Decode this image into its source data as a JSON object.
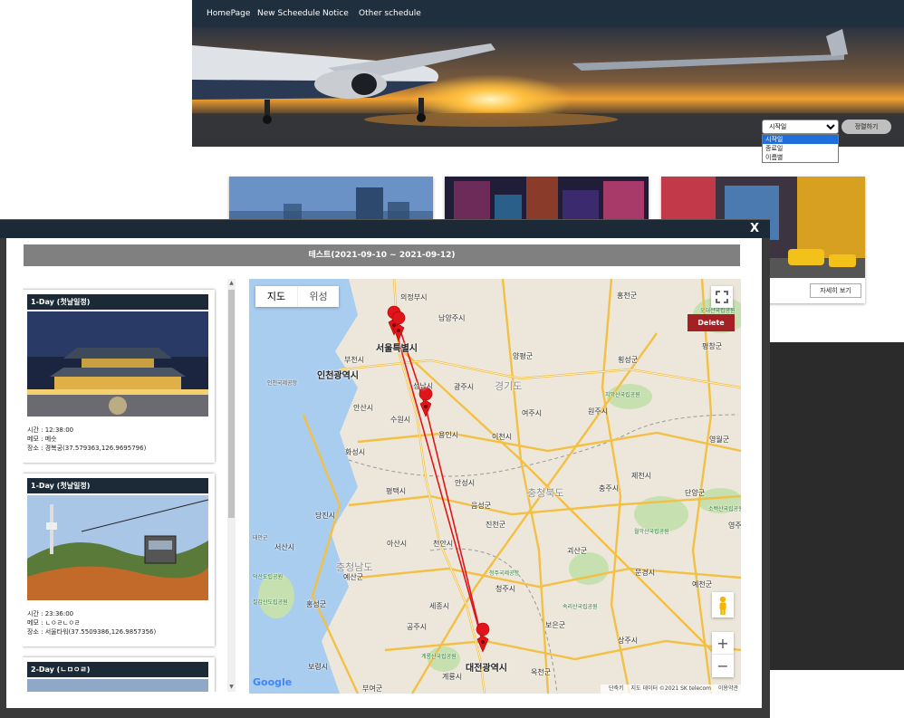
{
  "bg": {
    "nav": [
      "HomePage",
      "New Scheedule",
      "Notice",
      "Other schedule"
    ],
    "sort": {
      "selected": "시작일",
      "options": [
        "시작일",
        "종료일",
        "이름별"
      ],
      "button": "정렬하기"
    },
    "detail_button": "자세히 보기"
  },
  "modal": {
    "close": "X",
    "title": "테스트(2021-09-10 ~ 2021-09-12)",
    "days": [
      {
        "header": "1-Day (첫날일정)",
        "time": "시간 : 12:38:00",
        "memo": "메모 : 메슷",
        "place": "장소 : 경복궁(37.579363,126.9695796)"
      },
      {
        "header": "1-Day (첫날일정)",
        "time": "시간 : 23:36:00",
        "memo": "메모 : ㄴㅇㄹㄴㅇㄹ",
        "place": "장소 : 서울타워(37.5509386,126.9857356)"
      },
      {
        "header": "2-Day (ㄴㅁㅇㄹ)"
      }
    ]
  },
  "map": {
    "type_map": "지도",
    "type_sat": "위성",
    "delete": "Delete",
    "zoom_in": "+",
    "zoom_out": "−",
    "logo": "Google",
    "footer": [
      "단축키",
      "지도 데이터 ©2021 SK telecom",
      "이용약관"
    ],
    "accent_route": "#e0151b",
    "cities": [
      "의정부시",
      "남양주시",
      "홍천군",
      "서울특별시",
      "부천시",
      "인천광역시",
      "양평군",
      "횡성군",
      "평창군",
      "원주시",
      "안산시",
      "수원시",
      "성남시",
      "광주시",
      "경기도",
      "여주시",
      "용인시",
      "이천시",
      "화성시",
      "영월군",
      "평택시",
      "안성시",
      "충주시",
      "제천시",
      "당진시",
      "아산시",
      "천안시",
      "진천군",
      "음성군",
      "단양군",
      "서산시",
      "충청남도",
      "충청북도",
      "청주시",
      "괴산군",
      "문경시",
      "예산군",
      "홍성군",
      "공주시",
      "보은군",
      "상주시",
      "세종시",
      "대전광역시",
      "옥천군",
      "보령시",
      "부여군",
      "계룡시",
      "예천군",
      "영주",
      "태안군",
      "인천국제공항",
      "오대산국립공원",
      "치악산국립공원",
      "월악산국립공원",
      "소백산국립공원",
      "속리산국립공원",
      "계룡산국립공원",
      "덕산도립공원",
      "칠갑산도립공원",
      "청주국제공항"
    ]
  }
}
